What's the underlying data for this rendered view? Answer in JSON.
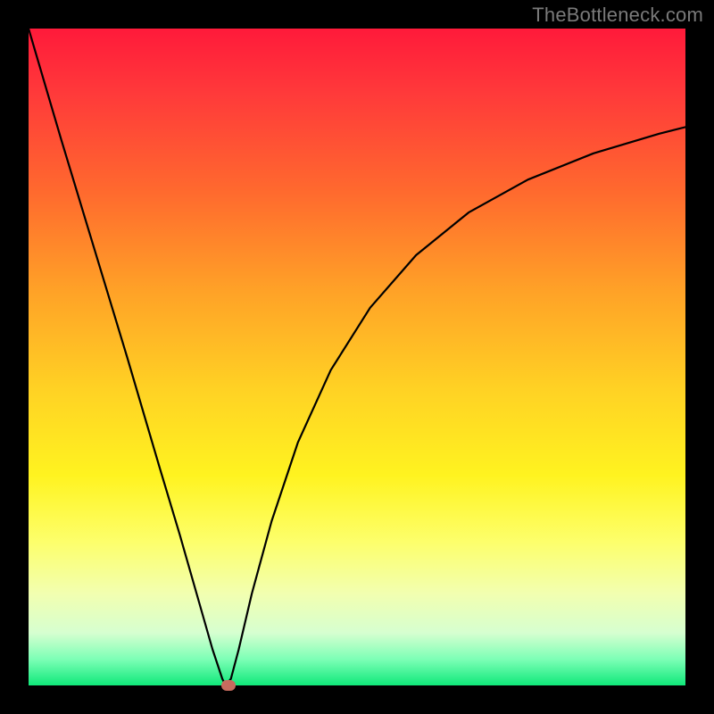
{
  "watermark": "TheBottleneck.com",
  "chart_data": {
    "type": "line",
    "title": "",
    "xlabel": "",
    "ylabel": "",
    "xlim": [
      0,
      1
    ],
    "ylim": [
      0,
      1
    ],
    "grid": false,
    "legend": false,
    "series": [
      {
        "name": "curve",
        "x": [
          0.0,
          0.05,
          0.1,
          0.15,
          0.2,
          0.23,
          0.26,
          0.28,
          0.295,
          0.3,
          0.308,
          0.32,
          0.34,
          0.37,
          0.41,
          0.46,
          0.52,
          0.59,
          0.67,
          0.76,
          0.86,
          0.96,
          1.0
        ],
        "y": [
          1.0,
          0.83,
          0.665,
          0.5,
          0.33,
          0.23,
          0.125,
          0.055,
          0.01,
          0.0,
          0.01,
          0.055,
          0.14,
          0.25,
          0.37,
          0.48,
          0.575,
          0.655,
          0.72,
          0.77,
          0.81,
          0.84,
          0.85
        ]
      }
    ],
    "marker": {
      "x": 0.305,
      "y": 0.0
    },
    "background_gradient": {
      "top": "#ff1a3a",
      "mid": "#ffe020",
      "bottom": "#10e87a"
    },
    "frame_color": "#000000"
  }
}
